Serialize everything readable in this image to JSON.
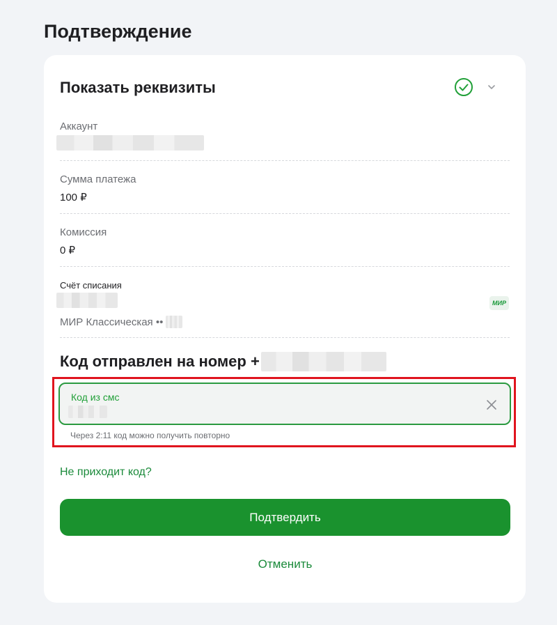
{
  "page": {
    "title": "Подтверждение"
  },
  "details": {
    "title": "Показать реквизиты",
    "account": {
      "label": "Аккаунт"
    },
    "amount": {
      "label": "Сумма платежа",
      "value": "100 ₽"
    },
    "commission": {
      "label": "Комиссия",
      "value": "0 ₽"
    },
    "debit_account": {
      "label": "Счёт списания",
      "card_name": "МИР Классическая ••",
      "badge": "МИР"
    }
  },
  "sms": {
    "sent_title": "Код отправлен на номер +",
    "field_label": "Код из смс",
    "hint": "Через 2:11 код можно получить повторно"
  },
  "actions": {
    "no_code_link": "Не приходит код?",
    "confirm": "Подтвердить",
    "cancel": "Отменить"
  },
  "colors": {
    "accent": "#1a922e",
    "highlight": "#e0141e"
  },
  "icons": {
    "check": "check-circle-icon",
    "chevron": "chevron-down-icon",
    "close": "close-icon"
  }
}
